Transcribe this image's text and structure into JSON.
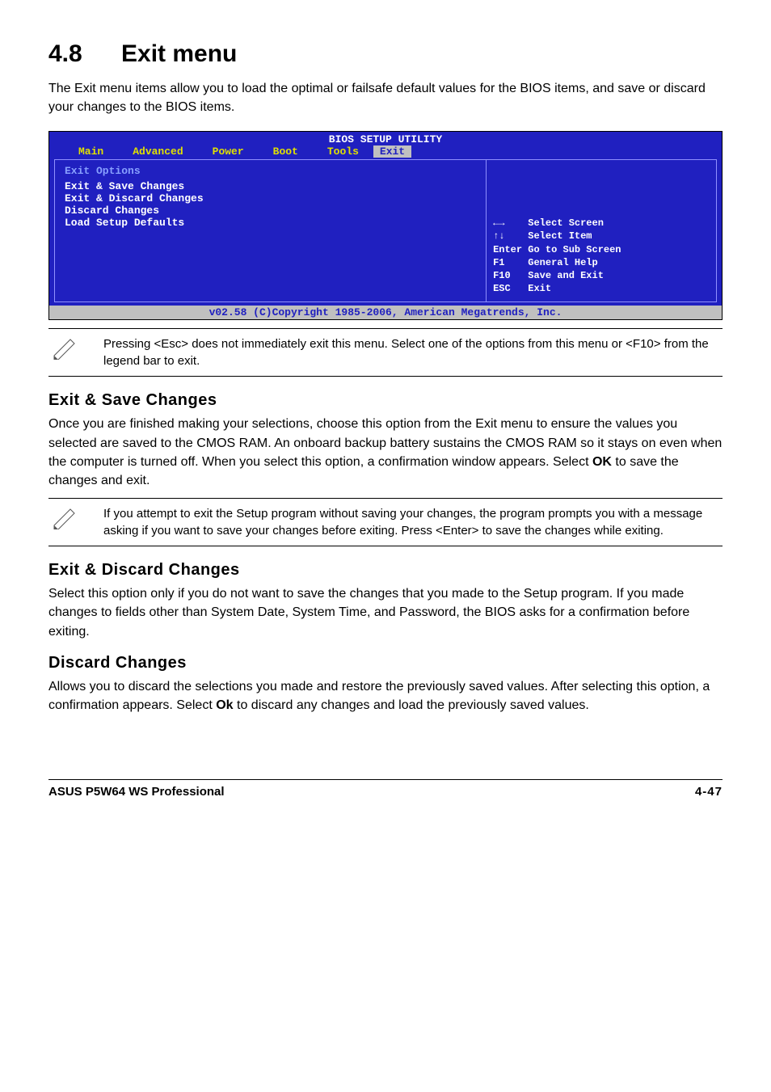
{
  "section_number": "4.8",
  "section_title": "Exit menu",
  "intro": "The Exit menu items allow you to load the optimal or failsafe default values for the BIOS items, and save or discard your changes to the BIOS items.",
  "bios": {
    "header": "BIOS SETUP UTILITY",
    "menu": [
      "Main",
      "Advanced",
      "Power",
      "Boot",
      "Tools",
      "Exit"
    ],
    "active_menu": "Exit",
    "left_heading": "Exit Options",
    "left_items": [
      "Exit & Save Changes",
      "Exit & Discard Changes",
      "Discard Changes",
      "",
      "Load Setup Defaults"
    ],
    "legend": [
      {
        "key": "←→",
        "label": "Select Screen"
      },
      {
        "key": "↑↓",
        "label": "Select Item"
      },
      {
        "key": "Enter",
        "label": "Go to Sub Screen"
      },
      {
        "key": "F1",
        "label": "General Help"
      },
      {
        "key": "F10",
        "label": "Save and Exit"
      },
      {
        "key": "ESC",
        "label": "Exit"
      }
    ],
    "footer": "v02.58 (C)Copyright 1985-2006, American Megatrends, Inc."
  },
  "note1": "Pressing <Esc> does not immediately exit this menu. Select one of the options from this menu or <F10> from the legend bar to exit.",
  "h_save": "Exit & Save Changes",
  "p_save_a": "Once you are finished making your selections, choose this option from the Exit menu to ensure the values you selected are saved to the CMOS RAM. An onboard backup battery sustains the CMOS RAM so it stays on even when the computer is turned off. When you select this option, a confirmation window appears. Select ",
  "p_save_bold": "OK",
  "p_save_b": " to save the changes and exit.",
  "note2": " If you attempt to exit the Setup program without saving your changes, the program prompts you with a message asking if you want to save your changes before exiting. Press <Enter>  to save the  changes while exiting.",
  "h_discard_exit": "Exit & Discard Changes",
  "p_discard_exit": "Select this option only if you do not want to save the changes that you made to the Setup program. If you made changes to fields other than System Date, System Time, and Password, the BIOS asks for a confirmation before exiting.",
  "h_discard": "Discard Changes",
  "p_discard_a": "Allows you to discard the selections you made and restore the previously saved values. After selecting this option, a confirmation appears. Select ",
  "p_discard_bold": "Ok",
  "p_discard_b": " to discard any changes and load the previously saved values.",
  "footer_product": "ASUS P5W64 WS Professional",
  "footer_page": "4-47"
}
